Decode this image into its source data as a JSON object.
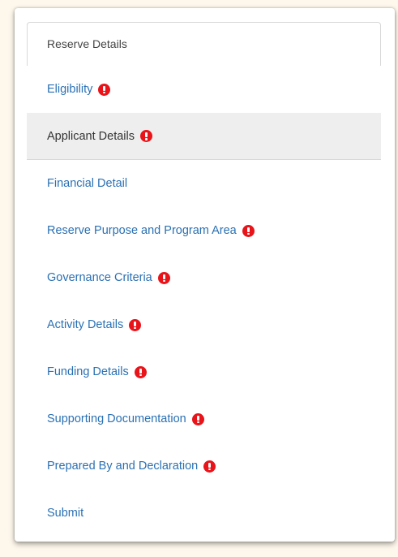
{
  "tab": {
    "label": "Reserve Details"
  },
  "nav": {
    "items": [
      {
        "label": "Eligibility",
        "warning": true,
        "active": false
      },
      {
        "label": "Applicant Details",
        "warning": true,
        "active": true
      },
      {
        "label": "Financial Detail",
        "warning": false,
        "active": false
      },
      {
        "label": "Reserve Purpose and Program Area",
        "warning": true,
        "active": false
      },
      {
        "label": "Governance Criteria",
        "warning": true,
        "active": false
      },
      {
        "label": "Activity Details",
        "warning": true,
        "active": false
      },
      {
        "label": "Funding Details",
        "warning": true,
        "active": false
      },
      {
        "label": "Supporting Documentation",
        "warning": true,
        "active": false
      },
      {
        "label": "Prepared By and Declaration",
        "warning": true,
        "active": false
      },
      {
        "label": "Submit",
        "warning": false,
        "active": false
      }
    ]
  },
  "colors": {
    "link": "#2a70b3",
    "warning": "#e8141a",
    "active_bg": "#eeeeee",
    "page_bg": "#fdf7ec"
  },
  "icons": {
    "warning": "exclamation-circle-icon"
  }
}
